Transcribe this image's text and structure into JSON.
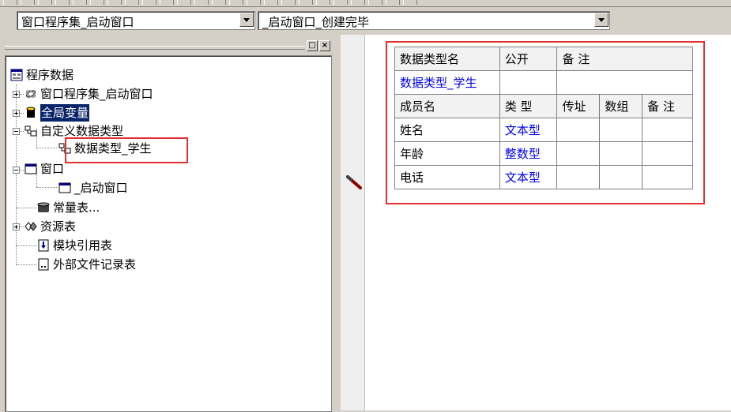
{
  "combos": {
    "left": "窗口程序集_启动窗口",
    "right": "_启动窗口_创建完毕"
  },
  "panel": {
    "restore_btn": "□",
    "close_btn": "×"
  },
  "tree": {
    "root": "程序数据",
    "items": [
      {
        "label": "窗口程序集_启动窗口"
      },
      {
        "label": "全局变量"
      },
      {
        "label": "自定义数据类型"
      },
      {
        "label": "数据类型_学生"
      },
      {
        "label": "窗口"
      },
      {
        "label": "_启动窗口"
      },
      {
        "label": "常量表..."
      },
      {
        "label": "资源表"
      },
      {
        "label": "模块引用表"
      },
      {
        "label": "外部文件记录表"
      }
    ]
  },
  "datatype": {
    "header": [
      "数据类型名",
      "公开",
      "备 注"
    ],
    "name": "数据类型_学生",
    "member_header": [
      "成员名",
      "类 型",
      "传址",
      "数组",
      "备 注"
    ],
    "members": [
      {
        "name": "姓名",
        "type": "文本型"
      },
      {
        "name": "年龄",
        "type": "整数型"
      },
      {
        "name": "电话",
        "type": "文本型"
      }
    ]
  },
  "colors": {
    "highlight": "#e03030",
    "type_link": "#0000e6",
    "selection": "#0a246a"
  }
}
